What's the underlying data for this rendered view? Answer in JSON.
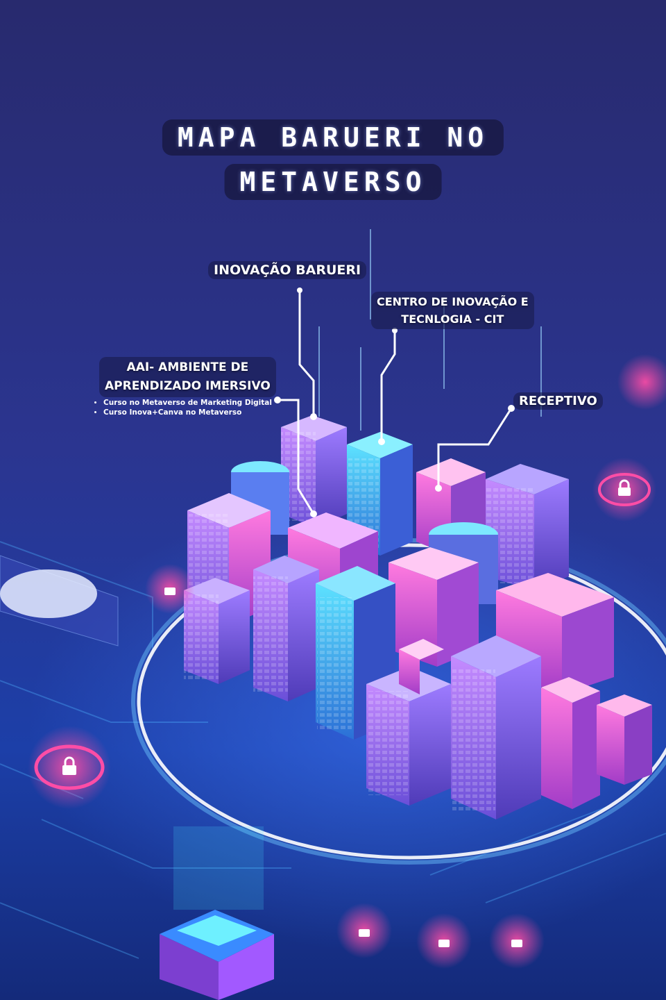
{
  "title": {
    "line1": "MAPA BARUERI NO",
    "line2": "METAVERSO"
  },
  "locations": {
    "inovacao": {
      "label": "INOVAÇÃO BARUERI"
    },
    "cit": {
      "line1": "CENTRO DE INOVAÇÃO E",
      "line2": "TECNLOGIA - CIT"
    },
    "aai": {
      "line1": "AAI- AMBIENTE DE",
      "line2": "APRENDIZADO IMERSIVO",
      "courses": [
        "Curso no Metaverso de Marketing Digital",
        "Curso Inova+Canva no Metaverso"
      ]
    },
    "receptivo": {
      "label": "RECEPTIVO"
    }
  },
  "colors": {
    "background": "#23266b",
    "accent_pink": "#ff3d8b",
    "accent_cyan": "#33d6ff",
    "building_purple": "#8a6cf0"
  },
  "icons": [
    "lock-icon"
  ]
}
